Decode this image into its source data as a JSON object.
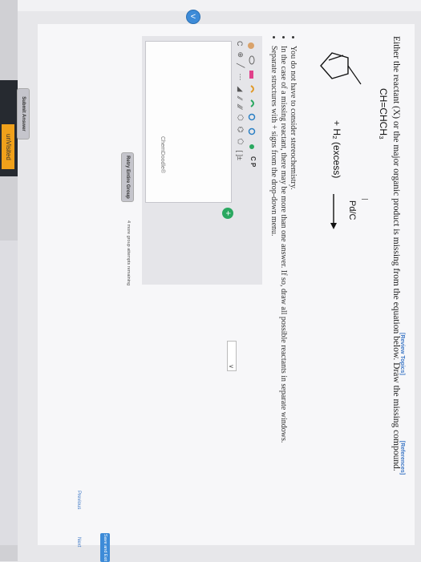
{
  "sidebar": {
    "tag_label": "unVisited",
    "collapse_symbol": "<"
  },
  "header": {
    "review_topics": "[Review Topics]",
    "references": "[References]"
  },
  "question": {
    "text": "Either the reactant (X) or the major organic product is missing from the equation below. Draw the missing compound."
  },
  "reaction": {
    "substituent": "CH=CHCH₃",
    "reagent": "+ H₂ (excess)",
    "catalyst": "Pd/C"
  },
  "notes": [
    "You do not have to consider stereochemistry.",
    "In the case of a missing reactant, there may be more than one answer. If so, draw all possible reactants in separate windows.",
    "Separate structures with + signs from the drop-down menu."
  ],
  "editor": {
    "watermark": "ChemDoodle®",
    "copy_paste_label": "C P",
    "copy_paste_sub": "opy aste",
    "c_button": "C",
    "charge_label": "[ ]±",
    "add_symbol": "+"
  },
  "dropdown": {
    "selected": "∨"
  },
  "actions": {
    "submit": "Submit Answer",
    "retry": "Retry Entire Group",
    "remaining_text": "4 more group attempts remaining",
    "previous": "Previous",
    "next": "Next",
    "save_exit": "Save and Exit"
  }
}
